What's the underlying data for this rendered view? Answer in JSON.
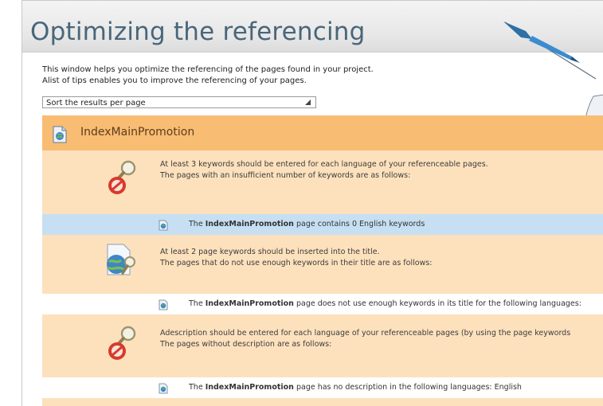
{
  "window": {
    "title": "Optimizing the referencing"
  },
  "intro": {
    "line1": "This window helps you optimize the referencing of the pages found in your project.",
    "line2": "Alist of tips enables you to improve the referencing of your pages."
  },
  "sort": {
    "value": "Sort the results per page"
  },
  "page": {
    "name": "IndexMainPromotion"
  },
  "tips": [
    {
      "icon": "magnifier-warning-icon",
      "line1": "At least 3 keywords should be entered for each language of your referenceable pages.",
      "line2": "The pages with an insufficient number of keywords are as follows:"
    },
    {
      "icon": "globe-magnifier-icon",
      "line1": "At least 2 page keywords should be inserted into the title.",
      "line2": "The pages that do not use enough keywords in their title are as follows:"
    },
    {
      "icon": "magnifier-warning-icon",
      "line1": "Adescription should be entered for each language of your referenceable pages (by using the page keywords",
      "line2": "The pages without description are as follows:"
    }
  ],
  "results": [
    {
      "prefix": "The ",
      "page": "IndexMainPromotion",
      "suffix": " page contains 0 English keywords"
    },
    {
      "prefix": "The ",
      "page": "IndexMainPromotion",
      "suffix": " page does not use enough keywords in its title for the following languages:"
    },
    {
      "prefix": "The ",
      "page": "IndexMainPromotion",
      "suffix": " page has no description in the following languages: English"
    }
  ],
  "colors": {
    "title": "#49667a",
    "page_header": "#f9bc73",
    "tip_background": "#fde1bd",
    "highlight_row": "#c6dff2"
  }
}
